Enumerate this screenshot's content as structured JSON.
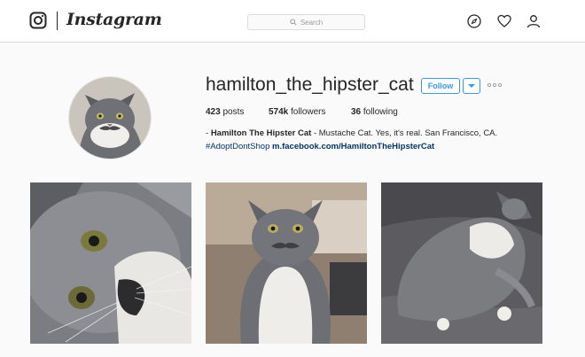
{
  "header": {
    "brand": "Instagram",
    "search_placeholder": "Search",
    "nav_icons": [
      "compass-icon",
      "heart-icon",
      "person-icon"
    ]
  },
  "profile": {
    "username": "hamilton_the_hipster_cat",
    "follow_label": "Follow",
    "stats": {
      "posts_count": "423",
      "posts_label": "posts",
      "followers_count": "574k",
      "followers_label": "followers",
      "following_count": "36",
      "following_label": "following"
    },
    "bio": {
      "dash": "- ",
      "name": "Hamilton The Hipster Cat",
      "text": " - Mustache Cat. Yes, it's real. San Francisco, CA.",
      "hashtag": "#AdoptDontShop",
      "website": "m.facebook.com/HamiltonTheHipsterCat"
    }
  },
  "posts": [
    {
      "alt": "Close-up of gray and white cat face"
    },
    {
      "alt": "Gray cat with white mustache sitting"
    },
    {
      "alt": "Gray cat lying on its back on bed"
    }
  ],
  "colors": {
    "accent": "#3897f0",
    "link": "#003569",
    "text": "#262626",
    "background": "#fafafa"
  }
}
